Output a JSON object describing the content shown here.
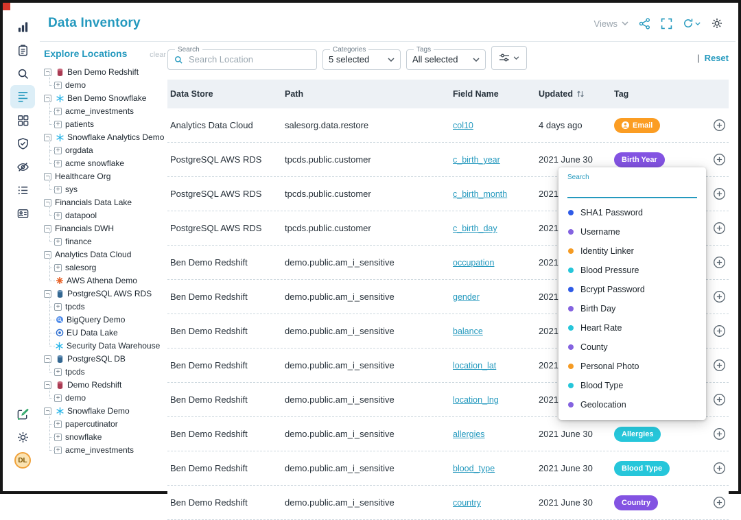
{
  "colors": {
    "accent": "#2499BE",
    "tag_orange": "#FB9D23",
    "tag_purple": "#8353E2",
    "tag_cyan": "#26C6DA",
    "dot_blue": "#2F5BE7",
    "dot_purple": "#8463E0",
    "dot_orange": "#F59B23",
    "dot_cyan": "#26C6DA"
  },
  "header": {
    "title": "Data Inventory",
    "views_label": "Views"
  },
  "rail": {
    "avatar_label": "DL"
  },
  "explore": {
    "title": "Explore Locations",
    "clear_label": "clear",
    "tree": [
      {
        "label": "Ben Demo Redshift",
        "level": 0,
        "toggle": "minus",
        "icon": "redshift"
      },
      {
        "label": "demo",
        "level": 1,
        "toggle": "plus"
      },
      {
        "label": "Ben Demo Snowflake",
        "level": 0,
        "toggle": "minus",
        "icon": "snowflake"
      },
      {
        "label": "acme_investments",
        "level": 1,
        "toggle": "plus"
      },
      {
        "label": "patients",
        "level": 1,
        "toggle": "plus"
      },
      {
        "label": "Snowflake Analytics Demo",
        "level": 0,
        "toggle": "minus",
        "icon": "snowflake"
      },
      {
        "label": "orgdata",
        "level": 1,
        "toggle": "plus"
      },
      {
        "label": "acme snowflake",
        "level": 1,
        "toggle": "plus"
      },
      {
        "label": "Healthcare Org",
        "level": 0,
        "toggle": "minus"
      },
      {
        "label": "sys",
        "level": 1,
        "toggle": "plus"
      },
      {
        "label": "Financials Data Lake",
        "level": 0,
        "toggle": "minus"
      },
      {
        "label": "datapool",
        "level": 1,
        "toggle": "plus"
      },
      {
        "label": "Financials DWH",
        "level": 0,
        "toggle": "minus"
      },
      {
        "label": "finance",
        "level": 1,
        "toggle": "plus"
      },
      {
        "label": "Analytics Data Cloud",
        "level": 0,
        "toggle": "minus"
      },
      {
        "label": "salesorg",
        "level": 1,
        "toggle": "plus"
      },
      {
        "label": "AWS Athena Demo",
        "level": 1,
        "icon": "athena"
      },
      {
        "label": "PostgreSQL AWS RDS",
        "level": 0,
        "toggle": "minus",
        "icon": "postgres"
      },
      {
        "label": "tpcds",
        "level": 1,
        "toggle": "plus"
      },
      {
        "label": "BigQuery Demo",
        "level": 1,
        "icon": "bigquery"
      },
      {
        "label": "EU Data Lake",
        "level": 1,
        "icon": "eulake"
      },
      {
        "label": "Security Data Warehouse",
        "level": 1,
        "icon": "snowflake"
      },
      {
        "label": "PostgreSQL DB",
        "level": 0,
        "toggle": "minus",
        "icon": "postgres"
      },
      {
        "label": "tpcds",
        "level": 1,
        "toggle": "plus"
      },
      {
        "label": "Demo Redshift",
        "level": 0,
        "toggle": "minus",
        "icon": "redshift"
      },
      {
        "label": "demo",
        "level": 1,
        "toggle": "plus"
      },
      {
        "label": "Snowflake Demo",
        "level": 0,
        "toggle": "minus",
        "icon": "snowflake"
      },
      {
        "label": "papercutinator",
        "level": 1,
        "toggle": "plus"
      },
      {
        "label": "snowflake",
        "level": 1,
        "toggle": "plus"
      },
      {
        "label": "acme_investments",
        "level": 1,
        "toggle": "plus"
      }
    ]
  },
  "filters": {
    "search_label": "Search",
    "search_placeholder": "Search Location",
    "categories_label": "Categories",
    "categories_value": "5 selected",
    "tags_label": "Tags",
    "tags_value": "All selected",
    "reset_label": "Reset"
  },
  "table": {
    "columns": [
      "Data Store",
      "Path",
      "Field Name",
      "Updated",
      "Tag"
    ],
    "rows": [
      {
        "store": "Analytics Data Cloud",
        "path": "salesorg.data.restore",
        "field": "col10",
        "updated": "4 days ago",
        "tag": {
          "label": "Email",
          "color": "#FB9D23",
          "icon": true
        }
      },
      {
        "store": "PostgreSQL AWS RDS",
        "path": "tpcds.public.customer",
        "field": "c_birth_year",
        "updated": "2021 June 30",
        "tag": {
          "label": "Birth Year",
          "color": "#8353E2"
        }
      },
      {
        "store": "PostgreSQL AWS RDS",
        "path": "tpcds.public.customer",
        "field": "c_birth_month",
        "updated": "2021 June 30",
        "tag": null
      },
      {
        "store": "PostgreSQL AWS RDS",
        "path": "tpcds.public.customer",
        "field": "c_birth_day",
        "updated": "2021 June 30",
        "tag": null
      },
      {
        "store": "Ben Demo Redshift",
        "path": "demo.public.am_i_sensitive",
        "field": "occupation",
        "updated": "2021 June 30",
        "tag": null
      },
      {
        "store": "Ben Demo Redshift",
        "path": "demo.public.am_i_sensitive",
        "field": "gender",
        "updated": "2021 June 30",
        "tag": null
      },
      {
        "store": "Ben Demo Redshift",
        "path": "demo.public.am_i_sensitive",
        "field": "balance",
        "updated": "2021 June 30",
        "tag": null
      },
      {
        "store": "Ben Demo Redshift",
        "path": "demo.public.am_i_sensitive",
        "field": "location_lat",
        "updated": "2021 June 30",
        "tag": null
      },
      {
        "store": "Ben Demo Redshift",
        "path": "demo.public.am_i_sensitive",
        "field": "location_lng",
        "updated": "2021 June 30",
        "tag": null
      },
      {
        "store": "Ben Demo Redshift",
        "path": "demo.public.am_i_sensitive",
        "field": "allergies",
        "updated": "2021 June 30",
        "tag": {
          "label": "Allergies",
          "color": "#26C6DA"
        }
      },
      {
        "store": "Ben Demo Redshift",
        "path": "demo.public.am_i_sensitive",
        "field": "blood_type",
        "updated": "2021 June 30",
        "tag": {
          "label": "Blood Type",
          "color": "#26C6DA"
        }
      },
      {
        "store": "Ben Demo Redshift",
        "path": "demo.public.am_i_sensitive",
        "field": "country",
        "updated": "2021 June 30",
        "tag": {
          "label": "Country",
          "color": "#8353E2"
        }
      }
    ]
  },
  "tag_popup": {
    "search_label": "Search",
    "search_value": "",
    "items": [
      {
        "label": "SHA1 Password",
        "color": "#2F5BE7"
      },
      {
        "label": "Username",
        "color": "#8463E0"
      },
      {
        "label": "Identity Linker",
        "color": "#F59B23"
      },
      {
        "label": "Blood Pressure",
        "color": "#26C6DA"
      },
      {
        "label": "Bcrypt Password",
        "color": "#2F5BE7"
      },
      {
        "label": "Birth Day",
        "color": "#8463E0"
      },
      {
        "label": "Heart Rate",
        "color": "#26C6DA"
      },
      {
        "label": "County",
        "color": "#8463E0"
      },
      {
        "label": "Personal Photo",
        "color": "#F59B23"
      },
      {
        "label": "Blood Type",
        "color": "#26C6DA"
      },
      {
        "label": "Geolocation",
        "color": "#8463E0"
      }
    ]
  }
}
